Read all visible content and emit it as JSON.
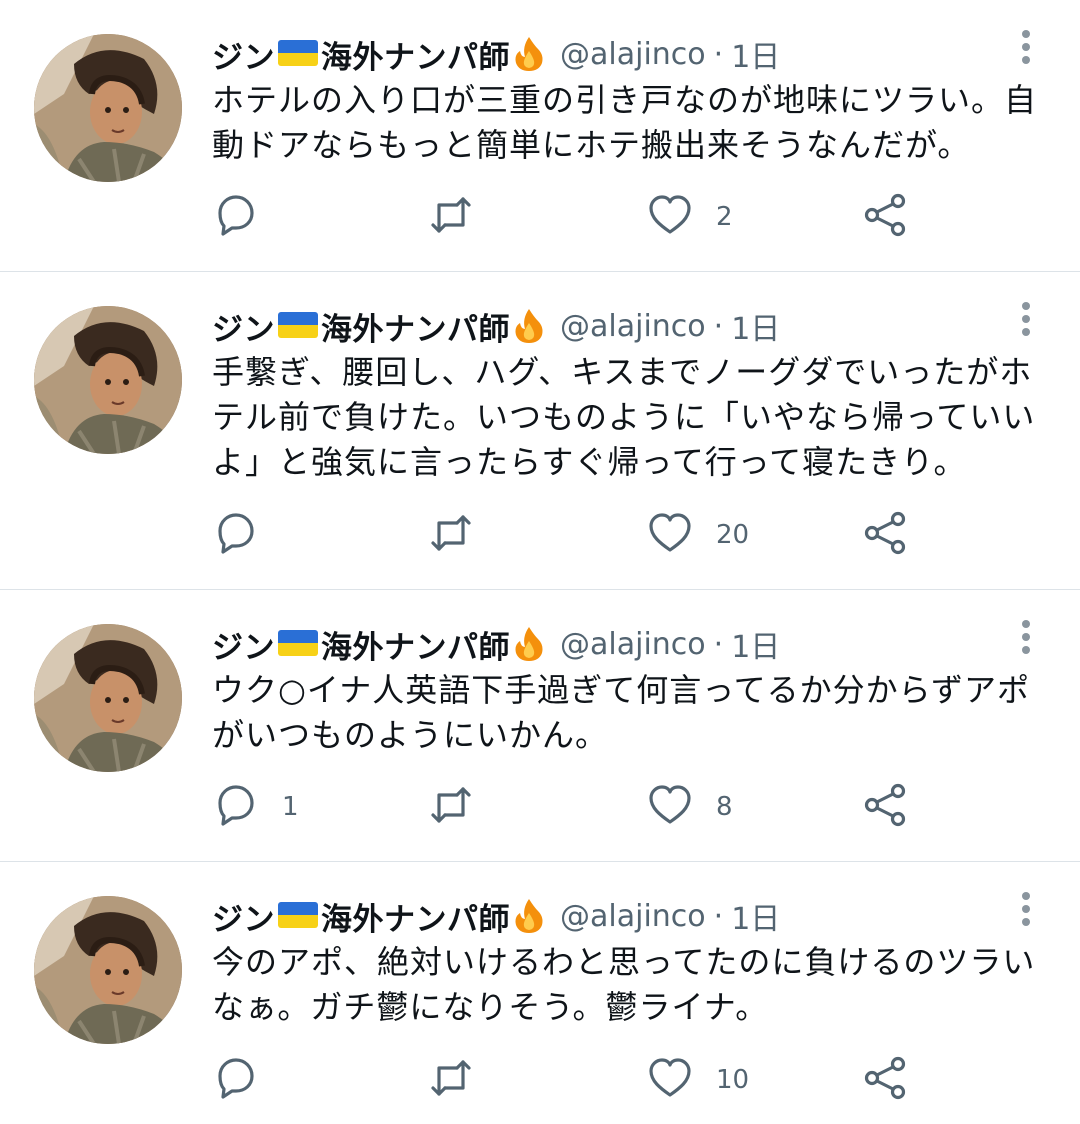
{
  "colors": {
    "text": "#0f1419",
    "secondary": "#536471",
    "flag_blue": "#2a6fd6",
    "flag_yellow": "#f7d117",
    "divider": "#dde3e8"
  },
  "tweets": [
    {
      "name": "ジン",
      "name2": "海外ナンパ師",
      "handle": "@alajinco",
      "dot": "·",
      "time": "1日",
      "lines": [
        "ホテルの入り口が三重の引き戸なのが地味にツラい。自",
        "動ドアならもっと簡単にホテ搬出来そうなんだが。"
      ],
      "replies": "",
      "retweets": "",
      "likes": "2"
    },
    {
      "name": "ジン",
      "name2": "海外ナンパ師",
      "handle": "@alajinco",
      "dot": "·",
      "time": "1日",
      "lines": [
        "手繋ぎ、腰回し、ハグ、キスまでノーグダでいったがホ",
        "テル前で負けた。いつものように「いやなら帰っていい",
        "よ」と強気に言ったらすぐ帰って行って寝たきり。"
      ],
      "replies": "",
      "retweets": "",
      "likes": "20"
    },
    {
      "name": "ジン",
      "name2": "海外ナンパ師",
      "handle": "@alajinco",
      "dot": "·",
      "time": "1日",
      "lines": [
        "ウク○イナ人英語下手過ぎて何言ってるか分からずアポ",
        "がいつものようにいかん。"
      ],
      "replies": "1",
      "retweets": "",
      "likes": "8"
    },
    {
      "name": "ジン",
      "name2": "海外ナンパ師",
      "handle": "@alajinco",
      "dot": "·",
      "time": "1日",
      "lines": [
        "今のアポ、絶対いけるわと思ってたのに負けるのツラい",
        "なぁ。ガチ鬱になりそう。鬱ライナ。"
      ],
      "replies": "",
      "retweets": "",
      "likes": "10"
    }
  ]
}
